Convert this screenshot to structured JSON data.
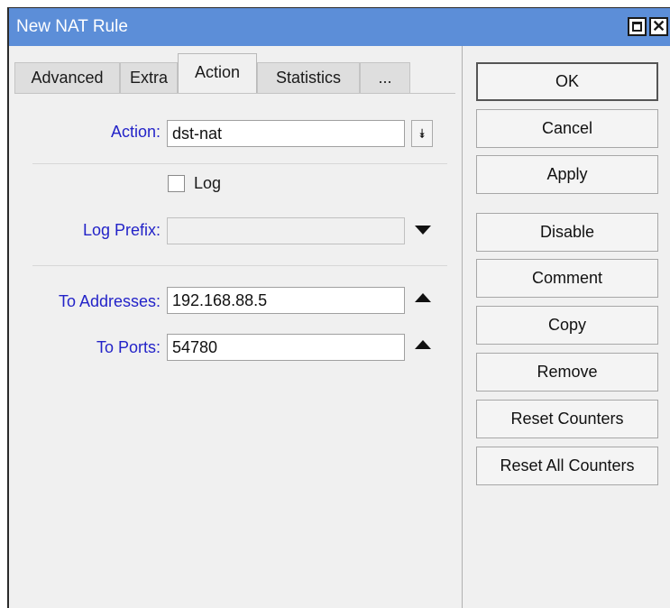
{
  "window": {
    "title": "New NAT Rule",
    "close_glyph": "✕"
  },
  "tabs": [
    {
      "label": "Advanced"
    },
    {
      "label": "Extra"
    },
    {
      "label": "Action",
      "active": true
    },
    {
      "label": "Statistics"
    },
    {
      "label": "..."
    }
  ],
  "form": {
    "action": {
      "label": "Action:",
      "value": "dst-nat",
      "dropdown_glyph": "⯯"
    },
    "log": {
      "label": "Log",
      "checked": false
    },
    "log_prefix": {
      "label": "Log Prefix:",
      "value": ""
    },
    "to_addresses": {
      "label": "To Addresses:",
      "value": "192.168.88.5"
    },
    "to_ports": {
      "label": "To Ports:",
      "value": "54780"
    }
  },
  "buttons": {
    "ok": "OK",
    "cancel": "Cancel",
    "apply": "Apply",
    "disable": "Disable",
    "comment": "Comment",
    "copy": "Copy",
    "remove": "Remove",
    "reset_counters": "Reset Counters",
    "reset_all_counters": "Reset All Counters"
  },
  "icons": {
    "maximize": "maximize-icon",
    "close": "close-icon",
    "dropdown": "dropdown-arrow-icon",
    "collapse": "collapse-arrow-icon",
    "expand": "expand-arrow-icon"
  },
  "colors": {
    "titlebar": "#5c8ed8",
    "label_blue": "#2323c8"
  }
}
